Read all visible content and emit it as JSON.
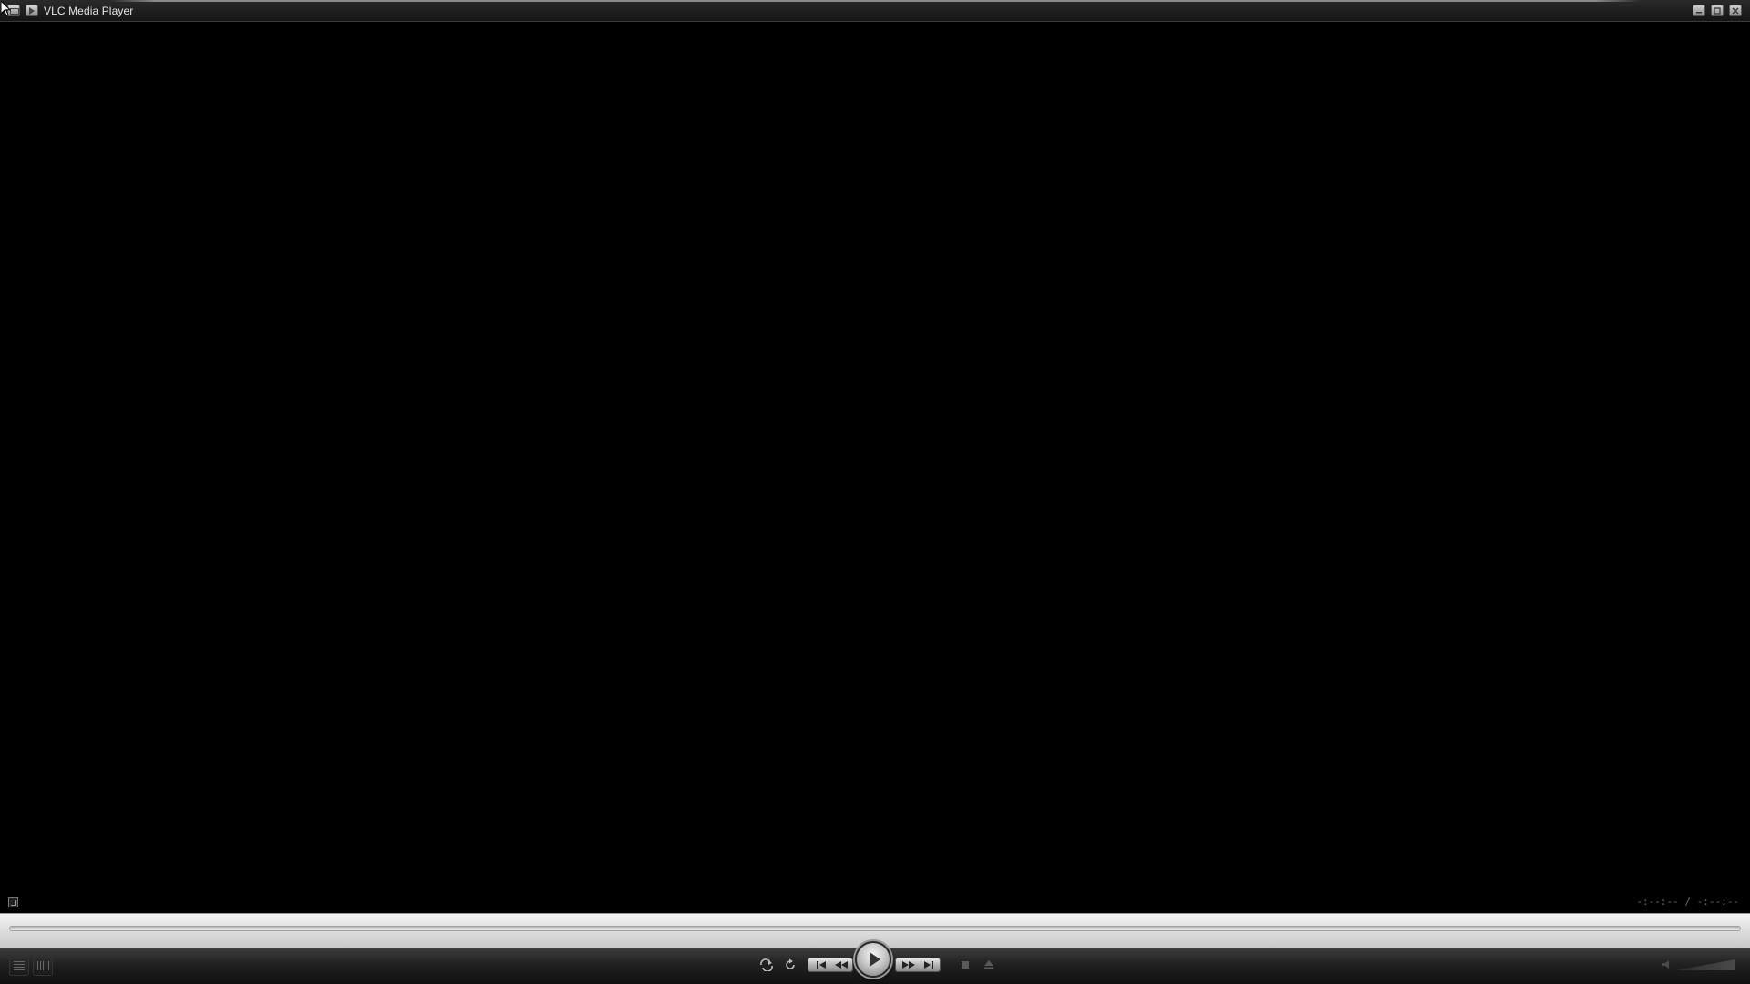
{
  "window": {
    "title": "VLC Media Player",
    "buttons": {
      "minimize_icon": "minimize-icon",
      "maximize_icon": "maximize-icon",
      "close_icon": "close-icon"
    }
  },
  "video": {
    "time_display": "-:--:-- / -:--:--"
  },
  "controls": {
    "left": [
      "playlist-icon",
      "equalizer-icon"
    ],
    "center": [
      "loop-icon",
      "shuffle-icon",
      "previous-icon",
      "rewind-icon",
      "play-icon",
      "fast-forward-icon",
      "next-icon",
      "stop-icon",
      "eject-icon"
    ],
    "right": [
      "volume-icon"
    ]
  },
  "colors": {
    "background": "#000000",
    "titlebar": "#1e1e1e",
    "seek_panel": "#e2e2e2",
    "control_bar": "#202020",
    "title_text": "#e6e6e6"
  }
}
